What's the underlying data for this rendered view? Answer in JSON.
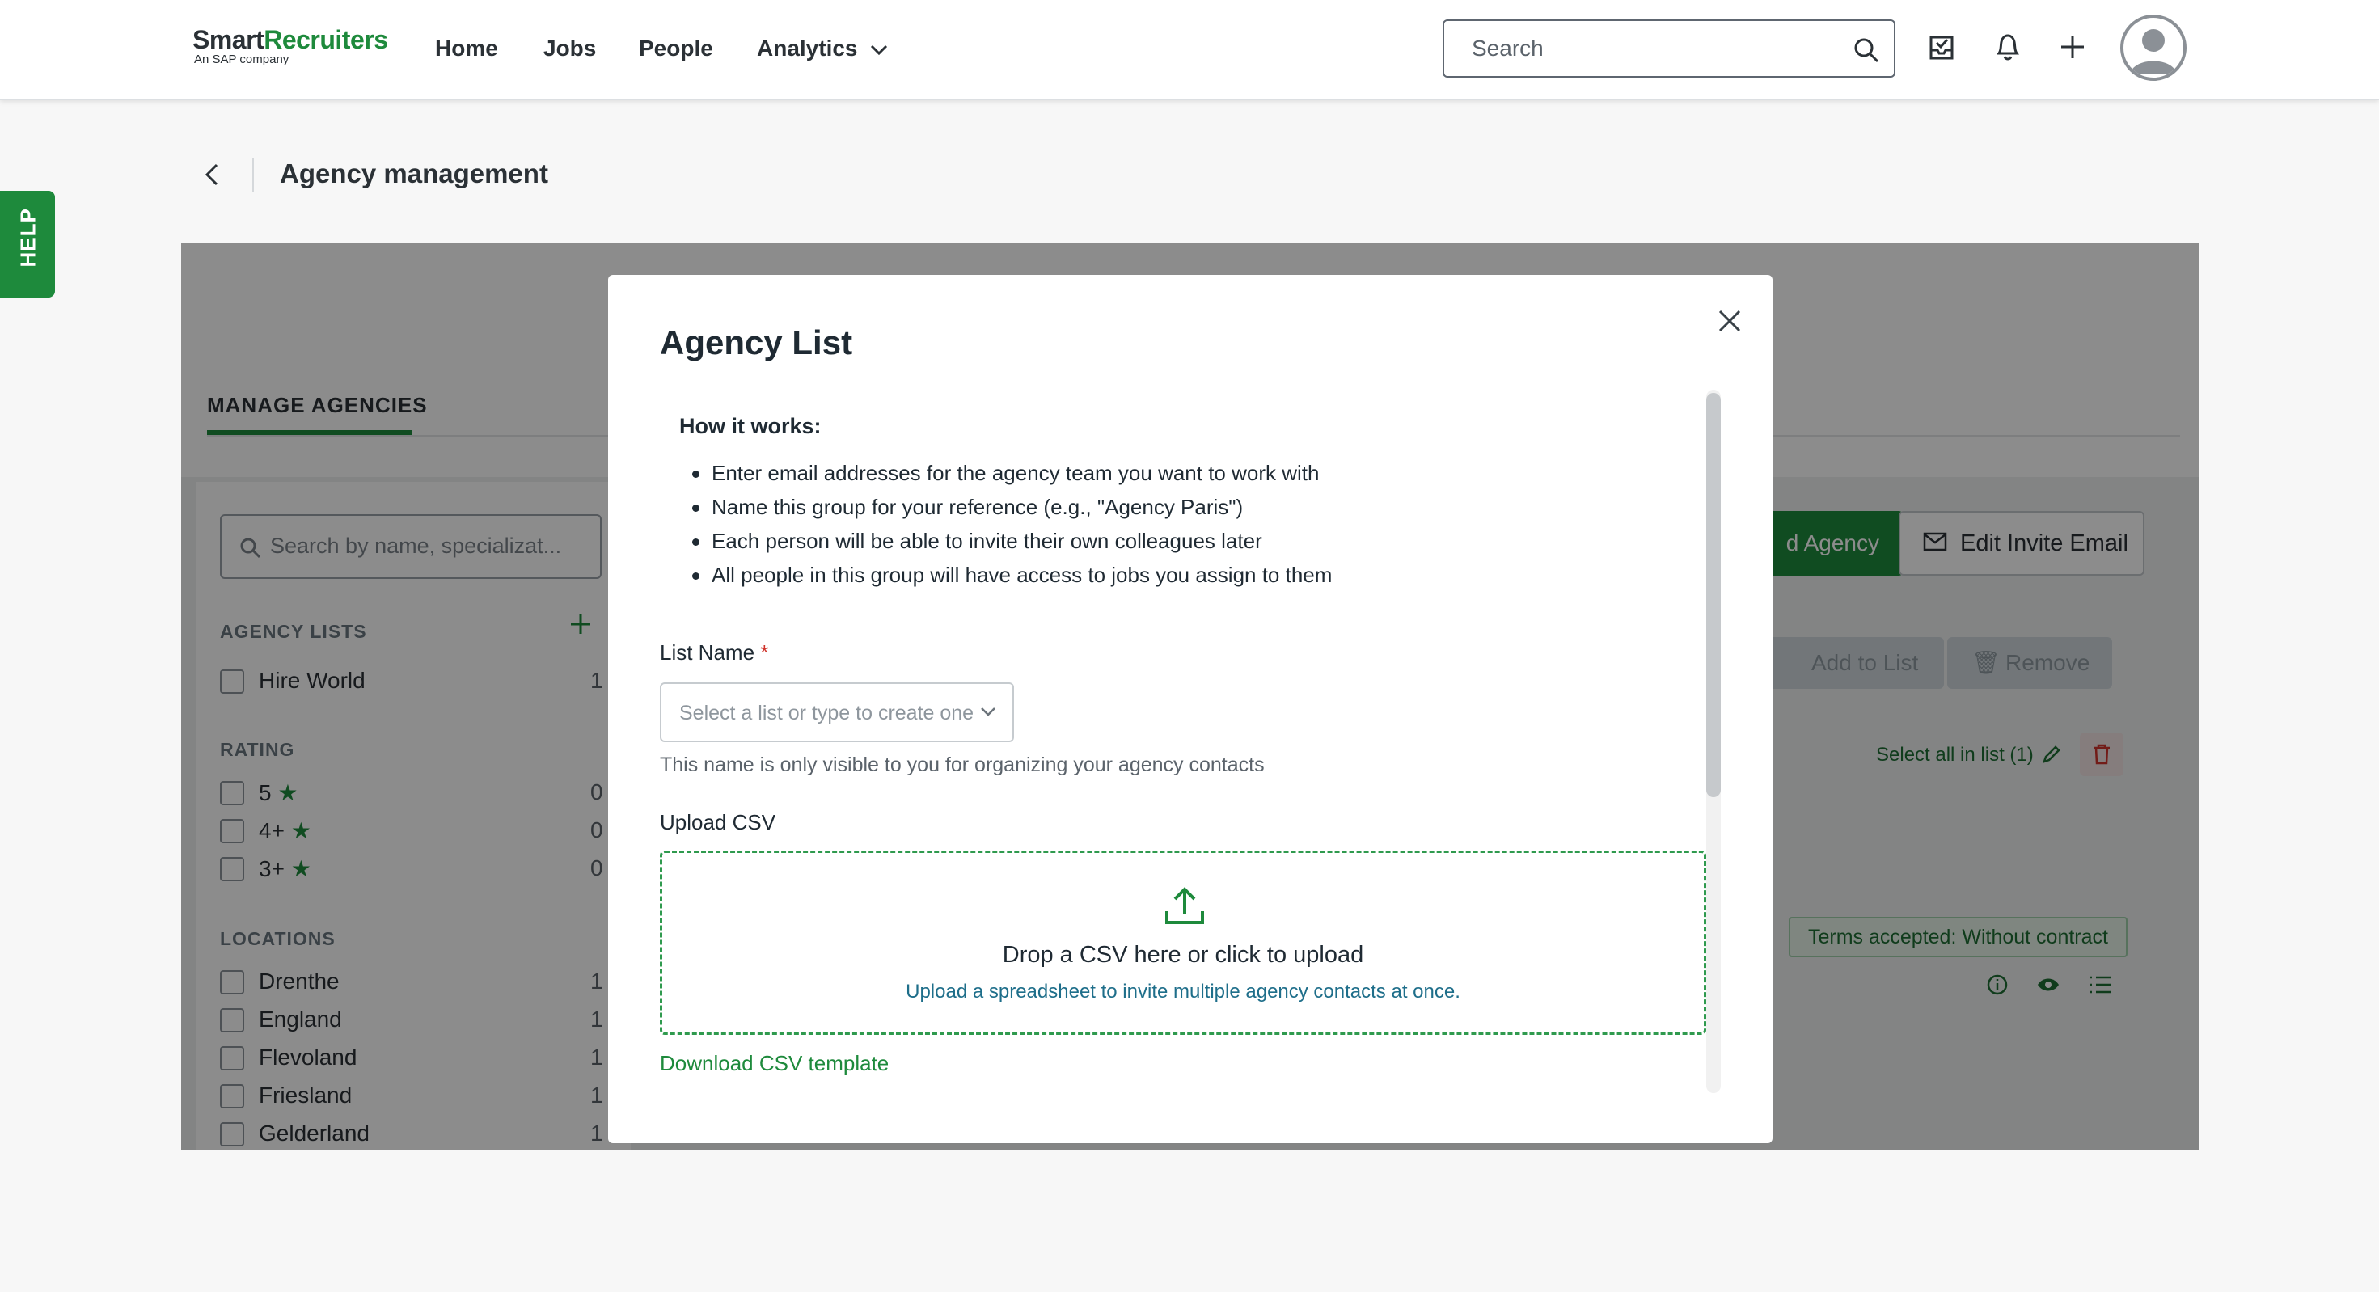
{
  "brand": {
    "logo_main_a": "Smart",
    "logo_main_b": "Recruiters",
    "logo_sub": "An SAP company",
    "accent": "#1e8a3c"
  },
  "nav": {
    "home": "Home",
    "jobs": "Jobs",
    "people": "People",
    "analytics": "Analytics"
  },
  "search": {
    "placeholder": "Search"
  },
  "help_tab": {
    "label": "HELP"
  },
  "page": {
    "title": "Agency management"
  },
  "tabs": {
    "manage": "MANAGE AGENCIES"
  },
  "filters": {
    "search_placeholder": "Search by name, specializat...",
    "agency_lists_title": "AGENCY LISTS",
    "agency_lists": [
      {
        "label": "Hire World",
        "count": "1"
      }
    ],
    "rating_title": "RATING",
    "ratings": [
      {
        "label": "5",
        "count": "0"
      },
      {
        "label": "4+",
        "count": "0"
      },
      {
        "label": "3+",
        "count": "0"
      }
    ],
    "locations_title": "LOCATIONS",
    "locations": [
      {
        "label": "Drenthe",
        "count": "1"
      },
      {
        "label": "England",
        "count": "1"
      },
      {
        "label": "Flevoland",
        "count": "1"
      },
      {
        "label": "Friesland",
        "count": "1"
      },
      {
        "label": "Gelderland",
        "count": "1"
      }
    ]
  },
  "actions": {
    "add_agency": "d Agency",
    "edit_invite": "Edit Invite Email",
    "add_to_list": "Add to List",
    "remove": "Remove",
    "select_all_in_list": "Select all in list (1)",
    "terms_badge": "Terms accepted: Without contract"
  },
  "modal": {
    "title": "Agency List",
    "how_it_works": "How it works:",
    "bullets": [
      "Enter email addresses for the agency team you want to work with",
      "Name this group for your reference (e.g., \"Agency Paris\")",
      "Each person will be able to invite their own colleagues later",
      "All people in this group will have access to jobs you assign to them"
    ],
    "list_name_label": "List Name",
    "required_mark": "*",
    "select_placeholder": "Select a list or type to create one",
    "list_name_hint": "This name is only visible to you for organizing your agency contacts",
    "upload_label": "Upload CSV",
    "drop_title": "Drop a CSV here or click to upload",
    "drop_subtitle": "Upload a spreadsheet to invite multiple agency contacts at once.",
    "download_link": "Download CSV template"
  }
}
